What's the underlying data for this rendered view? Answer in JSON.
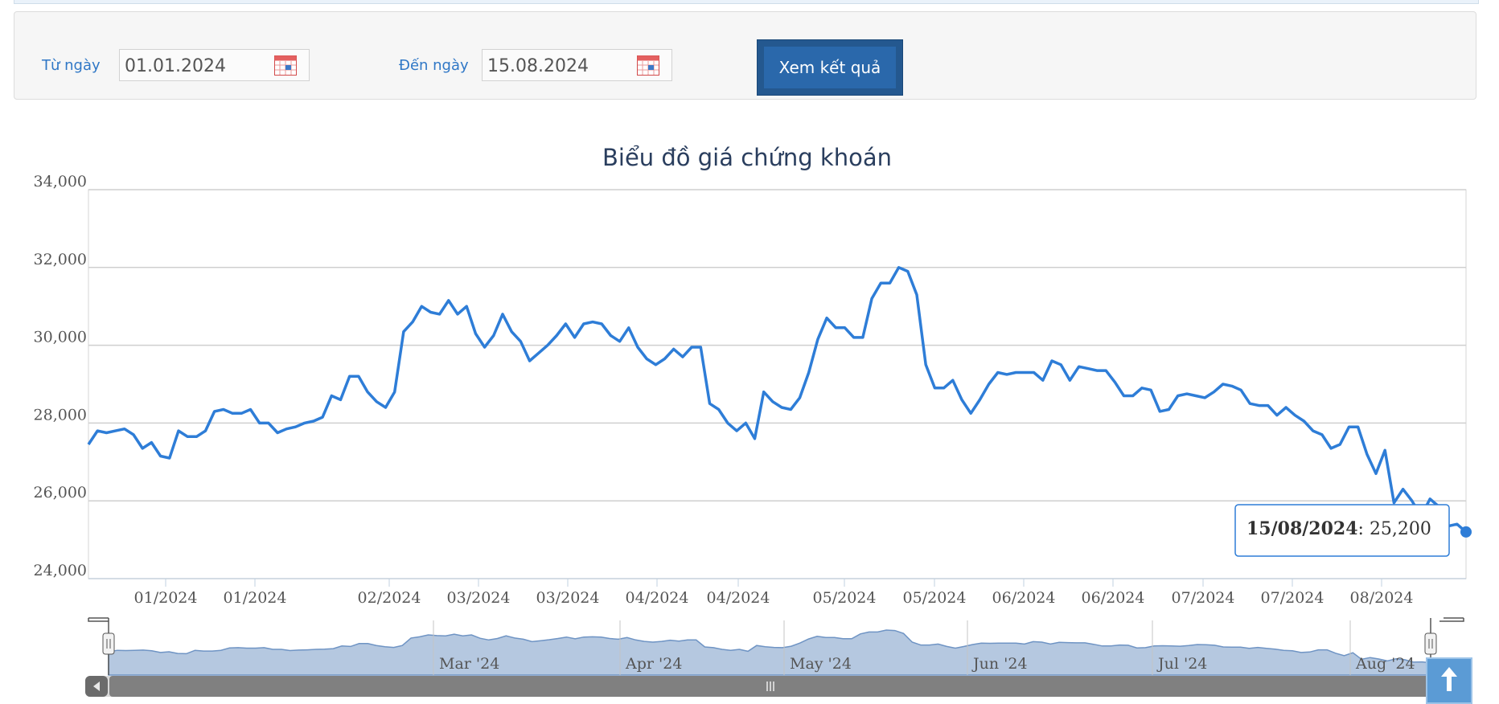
{
  "filter": {
    "from_label": "Từ ngày",
    "from_value": "01.01.2024",
    "to_label": "Đến ngày",
    "to_value": "15.08.2024",
    "submit_label": "Xem kết quả"
  },
  "icons": {
    "calendar": "calendar-icon",
    "scroll_top": "arrow-up-icon",
    "navigator_handle": "grip-icon",
    "scroll_left": "chevron-left-icon",
    "scrollbar_grip": "grip-icon"
  },
  "colors": {
    "accent": "#2f77c6",
    "series": "#2e7dd7",
    "navigator_fill": "#b5c8e0",
    "button": "#24588f"
  },
  "chart_data": {
    "type": "line",
    "title": "Biểu đồ giá chứng khoán",
    "xlabel": "",
    "ylabel": "",
    "ylim": [
      24000,
      34000
    ],
    "yticks": [
      "24,000",
      "26,000",
      "28,000",
      "30,000",
      "32,000",
      "34,000"
    ],
    "xtick_labels": [
      "01/2024",
      "01/2024",
      "02/2024",
      "03/2024",
      "03/2024",
      "04/2024",
      "04/2024",
      "05/2024",
      "05/2024",
      "06/2024",
      "06/2024",
      "07/2024",
      "07/2024",
      "08/2024"
    ],
    "grid": true,
    "legend": "none",
    "tooltip": {
      "date": "15/08/2024",
      "value": "25,200"
    },
    "navigator_labels": [
      "Mar '24",
      "Apr '24",
      "May '24",
      "Jun '24",
      "Jul '24",
      "Aug '24"
    ],
    "series": [
      {
        "values": [
          27450,
          27800,
          27750,
          27800,
          27850,
          27700,
          27350,
          27500,
          27150,
          27100,
          27800,
          27650,
          27650,
          27800,
          28300,
          28350,
          28250,
          28250,
          28350,
          28000,
          28000,
          27750,
          27850,
          27900,
          28000,
          28050,
          28150,
          28700,
          28600,
          29200,
          29200,
          28800,
          28550,
          28400,
          28800,
          30350,
          30600,
          31000,
          30850,
          30800,
          31150,
          30800,
          31000,
          30300,
          29950,
          30250,
          30800,
          30350,
          30100,
          29600,
          29800,
          30000,
          30250,
          30550,
          30200,
          30550,
          30600,
          30550,
          30250,
          30100,
          30450,
          29950,
          29650,
          29500,
          29650,
          29900,
          29700,
          29950,
          29950,
          28500,
          28350,
          28000,
          27800,
          28000,
          27600,
          28800,
          28550,
          28400,
          28350,
          28650,
          29300,
          30150,
          30700,
          30450,
          30450,
          30200,
          30200,
          31200,
          31600,
          31600,
          32000,
          31900,
          31300,
          29500,
          28900,
          28900,
          29100,
          28600,
          28250,
          28600,
          29000,
          29300,
          29250,
          29300,
          29300,
          29300,
          29100,
          29600,
          29500,
          29100,
          29450,
          29400,
          29350,
          29350,
          29050,
          28700,
          28700,
          28900,
          28850,
          28300,
          28350,
          28700,
          28750,
          28700,
          28650,
          28800,
          29000,
          28950,
          28850,
          28500,
          28450,
          28450,
          28200,
          28400,
          28200,
          28050,
          27800,
          27700,
          27350,
          27450,
          27900,
          27900,
          27200,
          26700,
          27300,
          25950,
          26300,
          26000,
          25600,
          26050,
          25850,
          25350,
          25400,
          25200
        ]
      }
    ]
  }
}
